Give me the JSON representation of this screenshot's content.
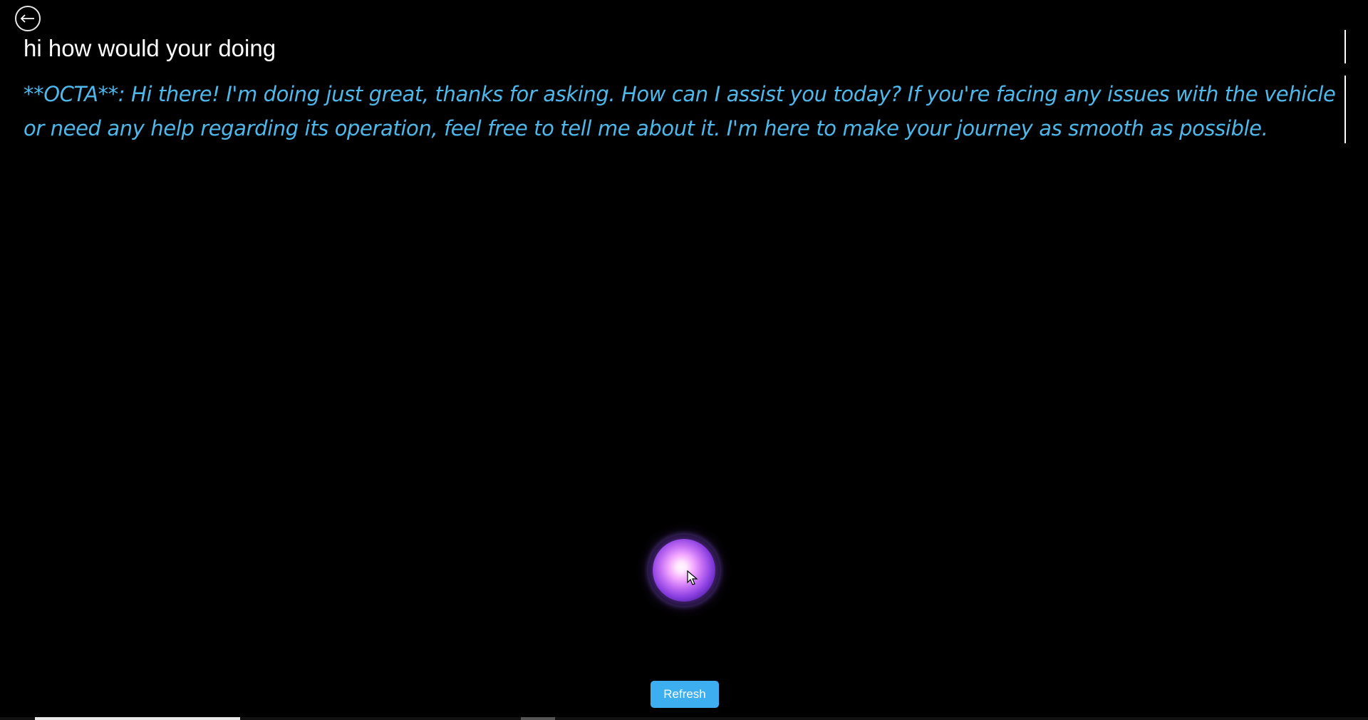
{
  "navigation": {
    "back_icon": "left-arrow-icon"
  },
  "conversation": {
    "user_message": "hi how would your doing",
    "ai_message": " **OCTA**: Hi there! I'm doing just great, thanks for asking. How can I assist you today? If you're facing any issues with the vehicle or need any help regarding its operation, feel free to tell me about it. I'm here to make your journey as smooth as possible."
  },
  "voice_orb": {
    "icon": "voice-orb-icon"
  },
  "controls": {
    "refresh_label": "Refresh"
  },
  "colors": {
    "background": "#000000",
    "user_text": "#ffffff",
    "ai_text": "#4fb8ea",
    "button": "#3daeef",
    "orb_core": "#ffe8ff",
    "orb_mid": "#c26cf3",
    "orb_outer": "#4e1fa5"
  }
}
